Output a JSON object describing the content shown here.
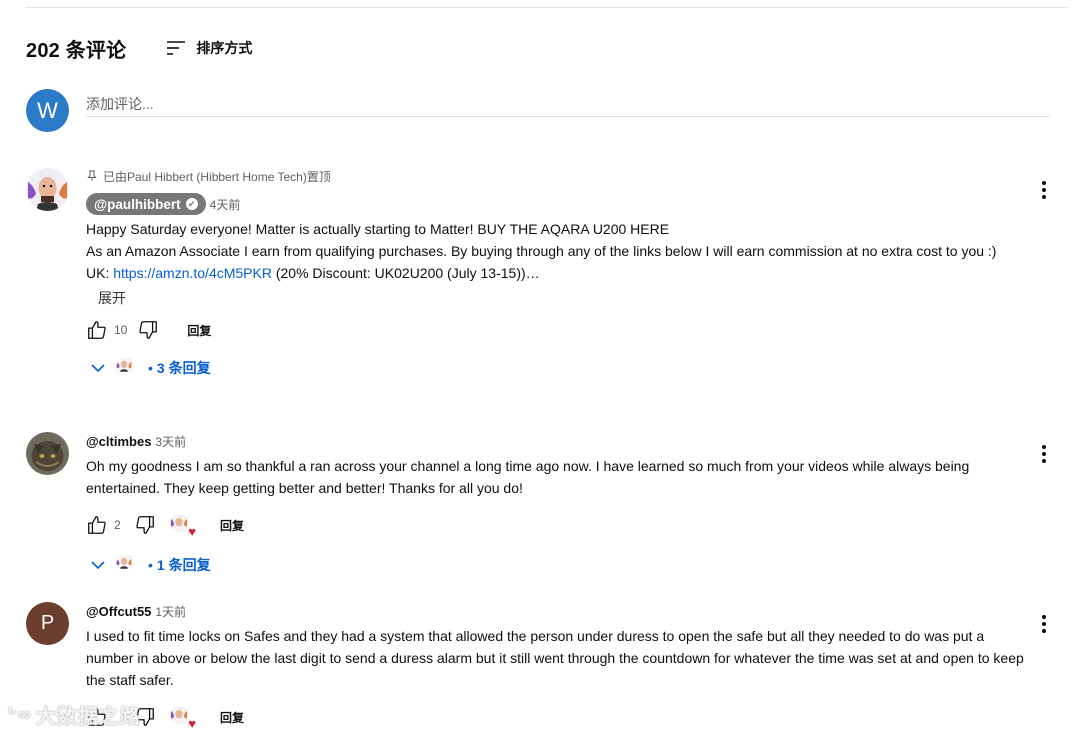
{
  "header": {
    "count_label": "202 条评论",
    "sort_label": "排序方式"
  },
  "add_comment": {
    "avatar_letter": "W",
    "placeholder": "添加评论...",
    "avatar_color": "#2c7bc9"
  },
  "comments": [
    {
      "pinned_text": "已由Paul Hibbert (Hibbert Home Tech)置顶",
      "handle": "@paulhibbert",
      "verified": true,
      "time": "4天前",
      "lines": [
        "Happy Saturday everyone! Matter is actually starting to Matter! BUY THE AQARA U200 HERE",
        "As an Amazon Associate I earn from qualifying purchases.  By buying through any of the links below I will earn commission at no extra cost to you :)"
      ],
      "link_prefix": "UK: ",
      "link_text": "https://amzn.to/4cM5PKR",
      "link_suffix": " (20% Discount: UK02U200 (July 13-15))…",
      "expand_label": "展开",
      "likes": "10",
      "reply_label": "回复",
      "replies_label": "3 条回复",
      "replies_dot": "•"
    },
    {
      "handle": "@cltimbes",
      "time": "3天前",
      "text": "Oh my goodness I am so thankful a ran across your channel a long time ago now.  I have learned so much from your videos while always being entertained.   They keep getting better and better!  Thanks for all you do!",
      "likes": "2",
      "reply_label": "回复",
      "replies_label": "1 条回复",
      "replies_dot": "•"
    },
    {
      "avatar_letter": "P",
      "avatar_color": "#6b3e2e",
      "handle": "@Offcut55",
      "time": "1天前",
      "text": "I used to fit time locks on Safes and they had a system that allowed the person under duress to open the safe but all they needed to do was put a number in above or below the last digit to send a duress alarm but it still went through the countdown for whatever the time was set at and open to keep the staff safer.",
      "likes": "",
      "reply_label": "回复"
    }
  ],
  "watermark": "大数据之路",
  "icons": {
    "sort": "sort-icon",
    "pin": "pin-icon",
    "like": "thumbs-up-icon",
    "dislike": "thumbs-down-icon",
    "chevron": "chevron-down-icon",
    "more": "more-vert-icon",
    "heart": "creator-heart-icon"
  },
  "colors": {
    "link": "#065fd4",
    "heart": "#e01e2b"
  }
}
